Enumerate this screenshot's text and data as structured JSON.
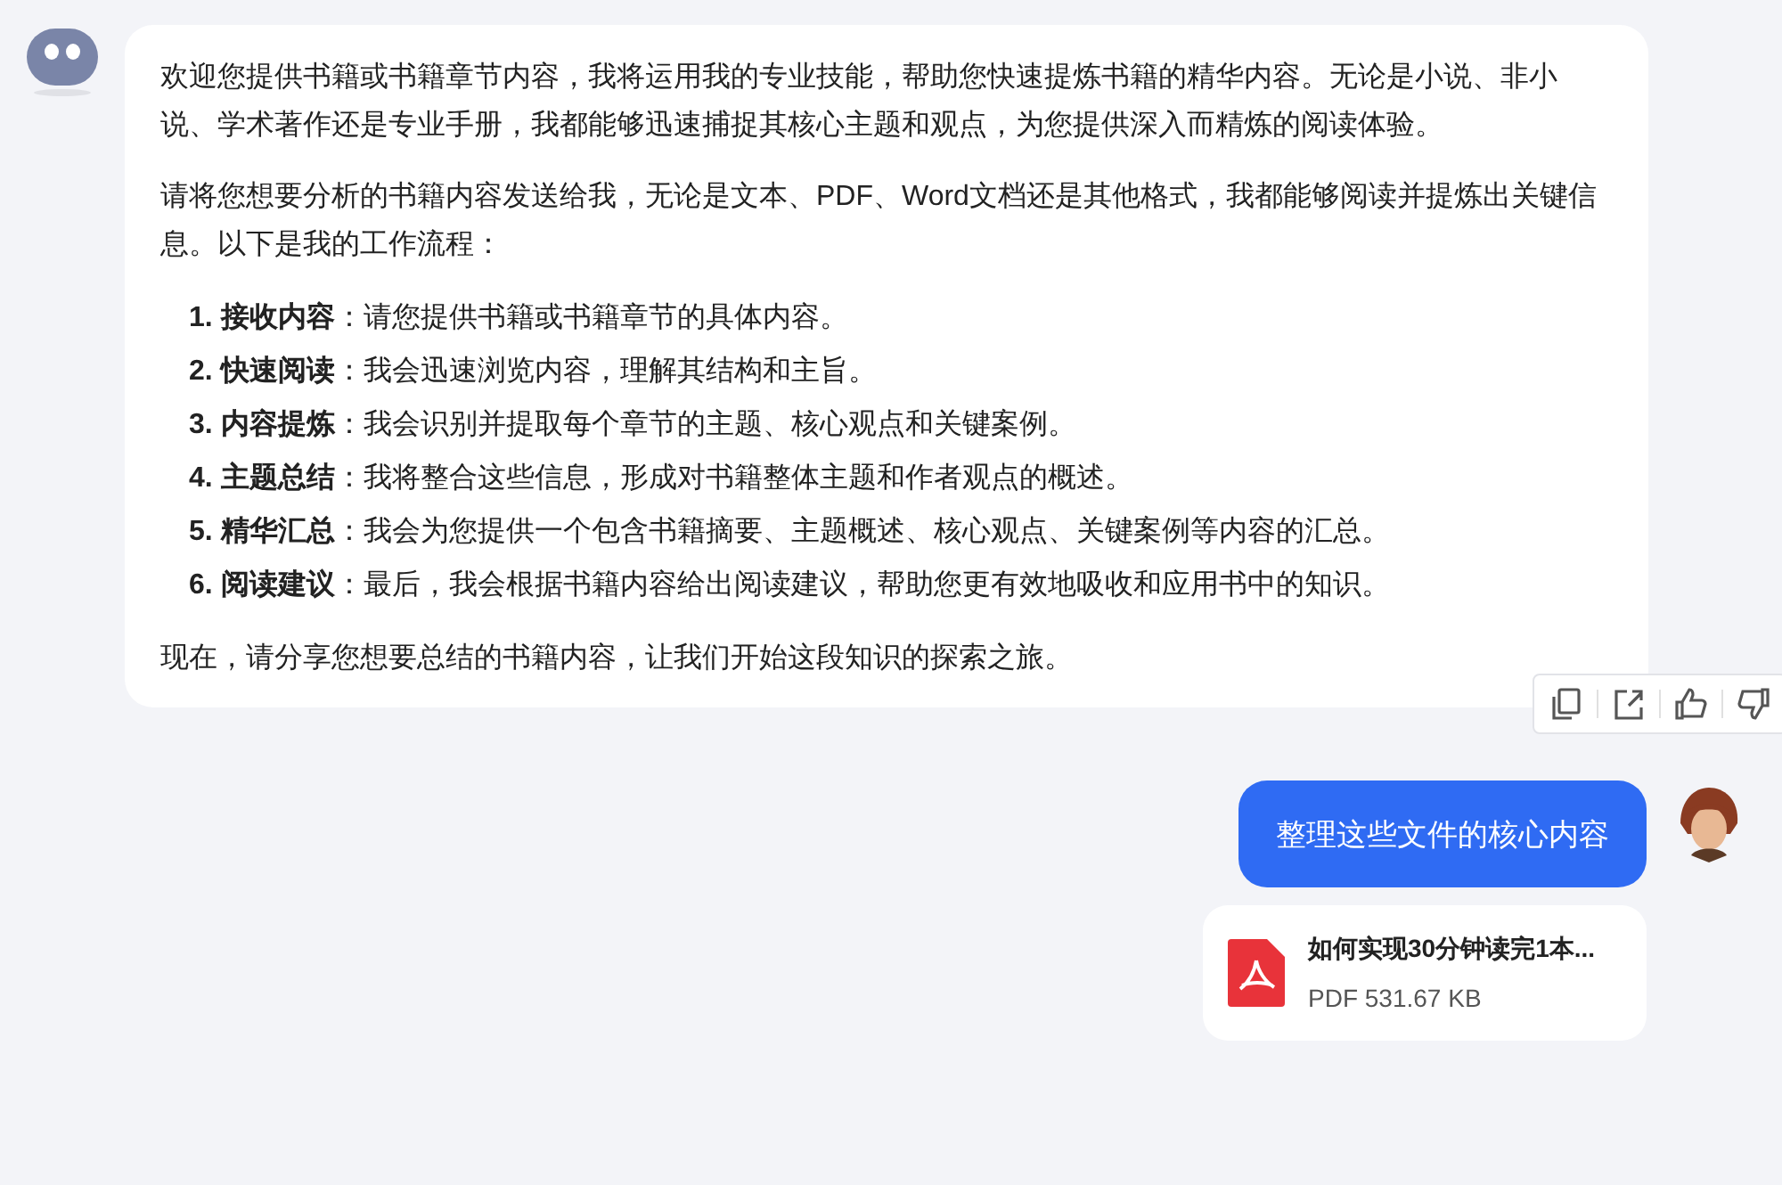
{
  "bot_message": {
    "paragraphs": [
      "欢迎您提供书籍或书籍章节内容，我将运用我的专业技能，帮助您快速提炼书籍的精华内容。无论是小说、非小说、学术著作还是专业手册，我都能够迅速捕捉其核心主题和观点，为您提供深入而精炼的阅读体验。",
      "请将您想要分析的书籍内容发送给我，无论是文本、PDF、Word文档还是其他格式，我都能够阅读并提炼出关键信息。以下是我的工作流程："
    ],
    "steps": [
      {
        "text": "**1. 接收内容**：请您提供书籍或书籍章节的具体内容。"
      },
      {
        "text": "**2. 快速阅读**：我会迅速浏览内容，理解其结构和主旨。"
      },
      {
        "text": "**3. 内容提炼**：我会识别并提取每个章节的主题、核心观点和关键案例。"
      },
      {
        "text": "**4. 主题总结**：我将整合这些信息，形成对书籍整体主题和作者观点的概述。"
      },
      {
        "text": "**5. 精华汇总**：我会为您提供一个包含书籍摘要、主题概述、核心观点、关键案例等内容的汇总。"
      },
      {
        "text": "**6. 阅读建议**：最后，我会根据书籍内容给出阅读建议，帮助您更有效地吸收和应用书中的知识。"
      }
    ],
    "closing": "现在，请分享您想要总结的书籍内容，让我们开始这段知识的探索之旅。",
    "actions": [
      {
        "kind": "copy"
      },
      {
        "kind": "share"
      },
      {
        "kind": "like"
      },
      {
        "kind": "dislike"
      }
    ]
  },
  "user_message": {
    "text": "整理这些文件的核心内容"
  },
  "attachment": {
    "kind": "pdf",
    "name": "如何实现30分钟读完1本...",
    "meta": "PDF 531.67 KB"
  }
}
